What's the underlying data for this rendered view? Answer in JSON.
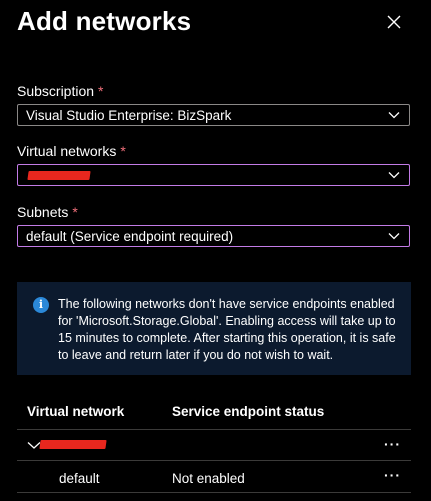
{
  "panel": {
    "title": "Add networks",
    "close_icon": "close-icon"
  },
  "subscription": {
    "label": "Subscription",
    "required_mark": "*",
    "value": "Visual Studio Enterprise: BizSpark"
  },
  "virtual_networks": {
    "label": "Virtual networks",
    "required_mark": "*",
    "value": "",
    "redacted": true
  },
  "subnets": {
    "label": "Subnets",
    "required_mark": "*",
    "value": "default (Service endpoint required)"
  },
  "info_banner": {
    "icon": "info-icon",
    "text": "The following networks don't have service endpoints enabled for 'Microsoft.Storage.Global'. Enabling access will take up to 15 minutes to complete. After starting this operation, it is safe to leave and return later if you do not wish to wait."
  },
  "table": {
    "columns": [
      "Virtual network",
      "Service endpoint status"
    ],
    "group_row": {
      "name_redacted": true,
      "more_label": "···"
    },
    "rows": [
      {
        "name": "default",
        "status": "Not enabled",
        "more_label": "···"
      }
    ]
  },
  "colors": {
    "background": "#000000",
    "required": "#f1707b",
    "focus_border": "#c27be6",
    "info_background": "#0c1a2e",
    "info_icon": "#2b88d8",
    "redaction": "#e8271e"
  }
}
